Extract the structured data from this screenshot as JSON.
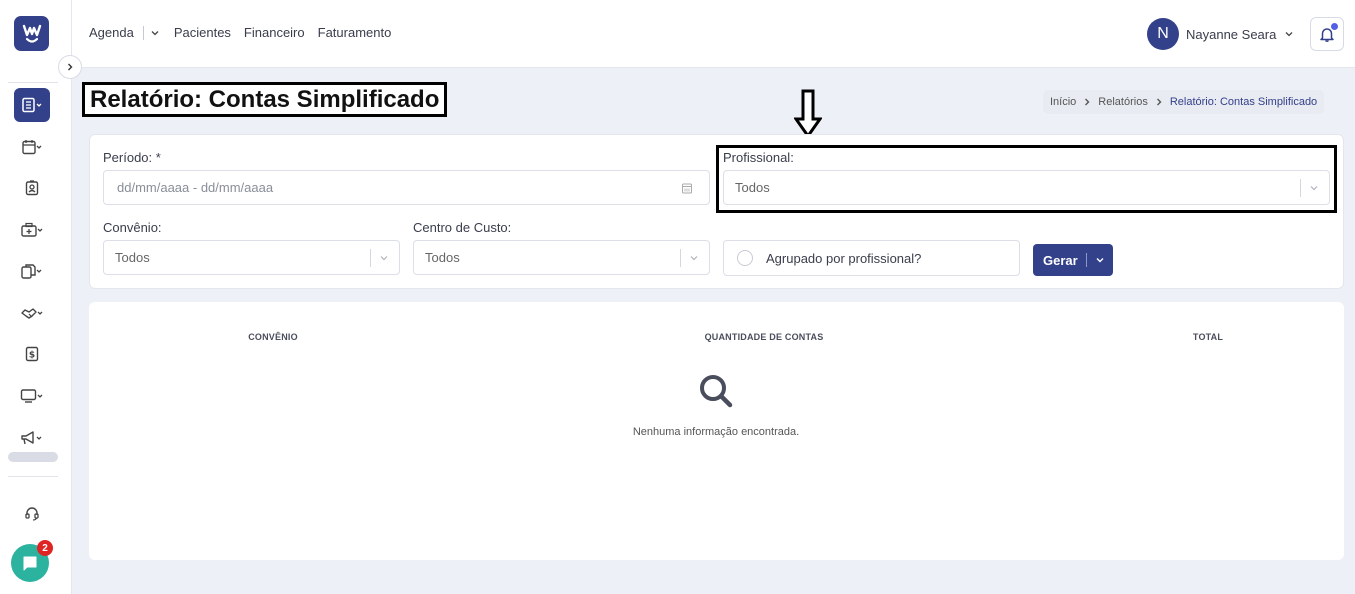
{
  "sidebar": {
    "logo_icon": "logo-w-icon",
    "items": [
      {
        "name": "reports",
        "icon": "report-book-icon",
        "active": true,
        "has_dropdown": true
      },
      {
        "name": "calendar",
        "icon": "calendar-icon",
        "has_dropdown": true
      },
      {
        "name": "patient",
        "icon": "patient-id-icon",
        "has_dropdown": false
      },
      {
        "name": "clinic",
        "icon": "hospital-icon",
        "has_dropdown": true
      },
      {
        "name": "documents",
        "icon": "documents-icon",
        "has_dropdown": true
      },
      {
        "name": "handshake",
        "icon": "handshake-icon",
        "has_dropdown": true
      },
      {
        "name": "finance",
        "icon": "dollar-doc-icon",
        "has_dropdown": false
      },
      {
        "name": "monitor",
        "icon": "monitor-icon",
        "has_dropdown": true
      },
      {
        "name": "marketing",
        "icon": "megaphone-icon",
        "has_dropdown": true
      }
    ],
    "support_icon": "headset-icon",
    "chat_badge": "2"
  },
  "topnav": {
    "items": [
      "Agenda",
      "Pacientes",
      "Financeiro",
      "Faturamento"
    ]
  },
  "user": {
    "initial": "N",
    "name": "Nayanne Seara"
  },
  "page": {
    "title": "Relatório: Contas Simplificado"
  },
  "breadcrumb": [
    "Início",
    "Relatórios",
    "Relatório: Contas Simplificado"
  ],
  "filters": {
    "periodo_label": "Período: *",
    "periodo_placeholder": "dd/mm/aaaa - dd/mm/aaaa",
    "profissional_label": "Profissional:",
    "profissional_value": "Todos",
    "convenio_label": "Convênio:",
    "convenio_value": "Todos",
    "centro_label": "Centro de Custo:",
    "centro_value": "Todos",
    "agrupado_label": "Agrupado por profissional?",
    "gerar_label": "Gerar"
  },
  "table": {
    "columns": [
      "CONVÊNIO",
      "QUANTIDADE DE CONTAS",
      "TOTAL"
    ],
    "empty_message": "Nenhuma informação encontrada."
  },
  "colors": {
    "primary": "#33408a",
    "chat": "#2bb3a0",
    "badge": "#e02424",
    "background": "#eef0f8"
  }
}
